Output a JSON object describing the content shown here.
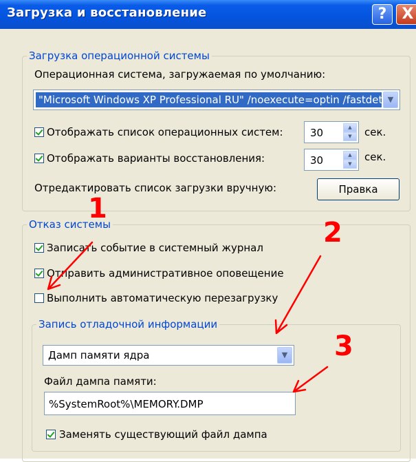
{
  "window": {
    "title": "Загрузка и восстановление",
    "help_label": "?",
    "close_label": "X"
  },
  "os_boot": {
    "legend": "Загрузка операционной системы",
    "default_os_label": "Операционная система, загружаемая по умолчанию:",
    "default_os_value": "\"Microsoft Windows XP Professional RU\" /noexecute=optin /fastdetect",
    "show_os_list_label": "Отображать список операционных систем:",
    "show_os_list_checked": true,
    "show_os_list_seconds": "30",
    "show_recovery_label": "Отображать варианты восстановления:",
    "show_recovery_checked": true,
    "show_recovery_seconds": "30",
    "seconds_unit": "сек.",
    "edit_manually_label": "Отредактировать список загрузки вручную:",
    "edit_button_label": "Правка"
  },
  "system_failure": {
    "legend": "Отказ системы",
    "write_event_label": "Записать событие в системный журнал",
    "write_event_checked": true,
    "send_alert_label": "Отправить административное оповещение",
    "send_alert_checked": true,
    "auto_restart_label": "Выполнить автоматическую перезагрузку",
    "auto_restart_checked": false
  },
  "debug_info": {
    "legend": "Запись отладочной информации",
    "dump_type_value": "Дамп памяти ядра",
    "dump_file_label": "Файл дампа памяти:",
    "dump_file_value": "%SystemRoot%\\MEMORY.DMP",
    "overwrite_label": "Заменять существующий файл дампа",
    "overwrite_checked": true
  },
  "annotations": {
    "marker_1": "1",
    "marker_2": "2",
    "marker_3": "3",
    "color": "#ff0000"
  },
  "colors": {
    "titlebar": "#0454df",
    "panel": "#ece9d8",
    "group_label": "#0046d5",
    "selection": "#316ac5"
  }
}
